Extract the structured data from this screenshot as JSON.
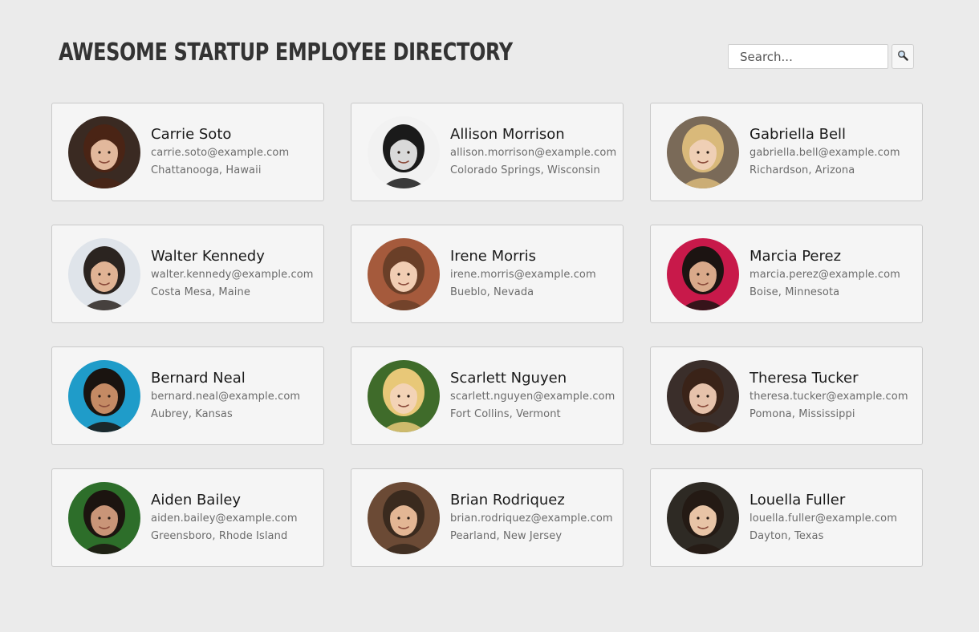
{
  "header": {
    "title": "Awesome Startup Employee Directory"
  },
  "search": {
    "placeholder": "Search...",
    "button_icon": "magnifier-icon"
  },
  "employees": [
    {
      "name": "Carrie Soto",
      "email": "carrie.soto@example.com",
      "location": "Chattanooga, Hawaii",
      "bg": "#3a2a22",
      "skin": "#e2b89c",
      "hair": "#4a2415"
    },
    {
      "name": "Allison Morrison",
      "email": "allison.morrison@example.com",
      "location": "Colorado Springs, Wisconsin",
      "bg": "#f2f2f2",
      "skin": "#d9d9d9",
      "hair": "#1a1a1a"
    },
    {
      "name": "Gabriella Bell",
      "email": "gabriella.bell@example.com",
      "location": "Richardson, Arizona",
      "bg": "#7a6a58",
      "skin": "#efcfb5",
      "hair": "#d9b97a"
    },
    {
      "name": "Walter Kennedy",
      "email": "walter.kennedy@example.com",
      "location": "Costa Mesa, Maine",
      "bg": "#dfe4ea",
      "skin": "#e0b394",
      "hair": "#2b2420"
    },
    {
      "name": "Irene Morris",
      "email": "irene.morris@example.com",
      "location": "Bueblo, Nevada",
      "bg": "#a55a3c",
      "skin": "#f1cdb3",
      "hair": "#6a3f28"
    },
    {
      "name": "Marcia Perez",
      "email": "marcia.perez@example.com",
      "location": "Boise, Minnesota",
      "bg": "#c8194a",
      "skin": "#d9a98a",
      "hair": "#1c1412"
    },
    {
      "name": "Bernard Neal",
      "email": "bernard.neal@example.com",
      "location": "Aubrey, Kansas",
      "bg": "#1f9cc9",
      "skin": "#c48a64",
      "hair": "#1a1410"
    },
    {
      "name": "Scarlett Nguyen",
      "email": "scarlett.nguyen@example.com",
      "location": "Fort Collins, Vermont",
      "bg": "#3f6b2a",
      "skin": "#f3d3b6",
      "hair": "#e8c878"
    },
    {
      "name": "Theresa Tucker",
      "email": "theresa.tucker@example.com",
      "location": "Pomona, Mississippi",
      "bg": "#3a2e2a",
      "skin": "#e6c2ab",
      "hair": "#3a2318"
    },
    {
      "name": "Aiden Bailey",
      "email": "aiden.bailey@example.com",
      "location": "Greensboro, Rhode Island",
      "bg": "#2d6e2a",
      "skin": "#c99578",
      "hair": "#1c1410"
    },
    {
      "name": "Brian Rodriquez",
      "email": "brian.rodriquez@example.com",
      "location": "Pearland, New Jersey",
      "bg": "#6b4a35",
      "skin": "#e3b694",
      "hair": "#3a2a1e"
    },
    {
      "name": "Louella Fuller",
      "email": "louella.fuller@example.com",
      "location": "Dayton, Texas",
      "bg": "#2e2a24",
      "skin": "#e8c4a6",
      "hair": "#241a14"
    }
  ]
}
